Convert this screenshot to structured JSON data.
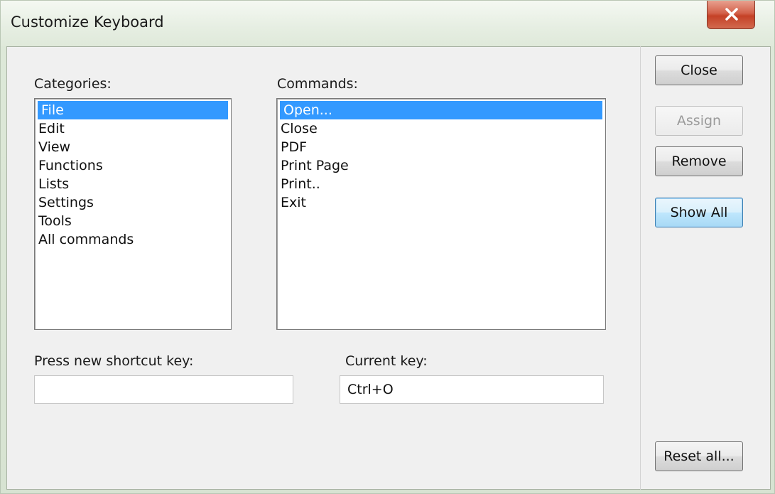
{
  "window": {
    "title": "Customize Keyboard"
  },
  "categories": {
    "label": "Categories:",
    "items": [
      "File",
      "Edit",
      "View",
      "Functions",
      "Lists",
      "Settings",
      "Tools",
      "All commands"
    ],
    "selected": "File"
  },
  "commands": {
    "label": "Commands:",
    "items": [
      "Open...",
      "Close",
      "PDF",
      "Print Page",
      "Print..",
      "Exit"
    ],
    "selected": "Open..."
  },
  "shortcut": {
    "label": "Press new shortcut key:",
    "value": ""
  },
  "current": {
    "label": "Current key:",
    "value": "Ctrl+O"
  },
  "buttons": {
    "close": "Close",
    "assign": "Assign",
    "remove": "Remove",
    "show_all": "Show All",
    "reset_all": "Reset all..."
  },
  "colors": {
    "selection": "#3399ff",
    "close_button": "#c44127"
  },
  "icons": {
    "window_close": "close-icon"
  }
}
